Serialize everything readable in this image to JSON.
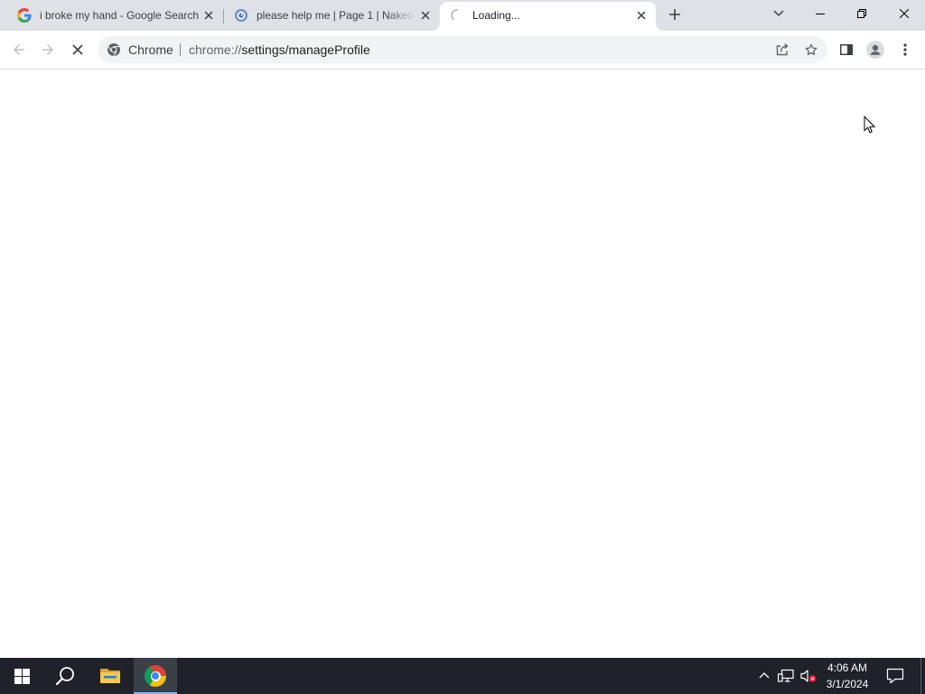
{
  "browser": {
    "tabs": [
      {
        "title": "i broke my hand - Google Search",
        "icon": "google-g-icon",
        "active": false
      },
      {
        "title": "please help me | Page 1 | Naked",
        "icon": "site-favicon-icon",
        "active": false
      },
      {
        "title": "Loading...",
        "icon": "loading-spinner-icon",
        "active": true
      }
    ],
    "strip_icons": [
      "new-tab-plus-icon",
      "tab-search-chevron-icon",
      "minimize-icon",
      "restore-icon",
      "close-icon"
    ],
    "toolbar": {
      "back_enabled": false,
      "forward_enabled": false,
      "reload_icon": "stop-icon",
      "omnibox": {
        "chip_icon": "chrome-page-icon",
        "chip_label": "Chrome",
        "url_scheme": "chrome://",
        "url_path": "settings/manageProfile",
        "action_icons": [
          "share-icon",
          "bookmark-star-icon"
        ]
      },
      "right_icons": [
        "side-panel-icon",
        "profile-avatar-icon",
        "more-menu-icon"
      ]
    }
  },
  "taskbar": {
    "apps": [
      {
        "icon": "windows-start-icon",
        "active": false
      },
      {
        "icon": "search-icon",
        "active": false
      },
      {
        "icon": "file-explorer-icon",
        "active": false
      },
      {
        "icon": "chrome-icon",
        "active": true
      }
    ],
    "tray_icons": [
      "chevron-up-icon",
      "network-icon",
      "volume-muted-icon",
      "notification-icon"
    ],
    "clock": {
      "time": "4:06 AM",
      "date": "3/1/2024"
    }
  },
  "colors": {
    "tab_strip": "#dee1e6",
    "toolbar": "#ffffff",
    "omnibox": "#f1f3f4",
    "taskbar": "#1f2229",
    "taskbar_active": "#3b3f47",
    "taskbar_accent": "#76b9ed",
    "text_dark": "#202124",
    "text_muted": "#5f6368",
    "icon": "#3c4043",
    "icon_disabled": "#bdc1c6",
    "divider": "#dadce0"
  }
}
